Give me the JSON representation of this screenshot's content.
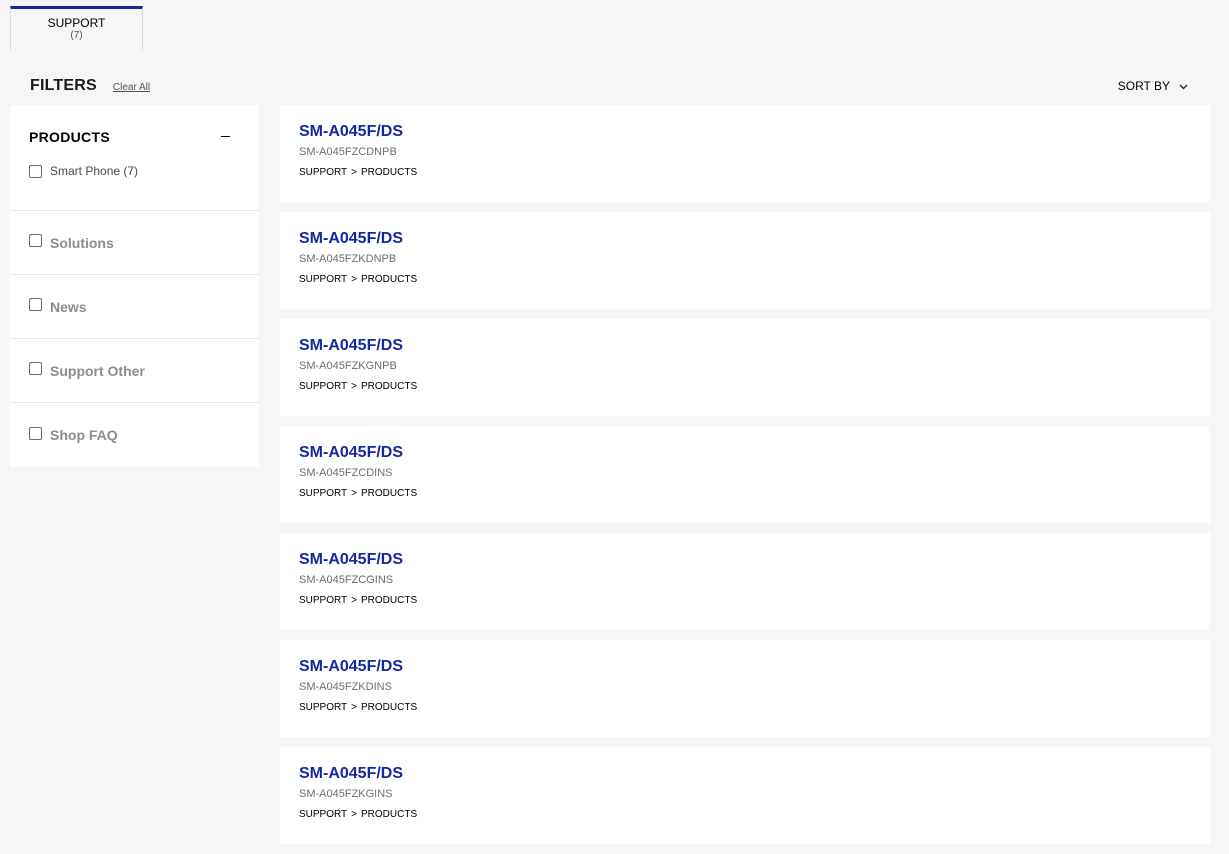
{
  "tabs": [
    {
      "label": "SUPPORT",
      "count": "(7)"
    }
  ],
  "filters": {
    "title": "FILTERS",
    "clear_all": "Clear All",
    "sort_by": "SORT BY"
  },
  "sidebar": {
    "products": {
      "title": "PRODUCTS",
      "collapse_icon": "minus-icon",
      "options": [
        {
          "label": "Smart Phone (7)",
          "checked": false
        }
      ]
    },
    "groups": [
      {
        "label": "Solutions",
        "checked": false
      },
      {
        "label": "News",
        "checked": false
      },
      {
        "label": "Support Other",
        "checked": false
      },
      {
        "label": "Shop FAQ",
        "checked": false
      }
    ]
  },
  "results": [
    {
      "title": "SM-A045F/DS",
      "sku": "SM-A045FZCDNPB",
      "path": [
        "SUPPORT",
        "PRODUCTS"
      ]
    },
    {
      "title": "SM-A045F/DS",
      "sku": "SM-A045FZKDNPB",
      "path": [
        "SUPPORT",
        "PRODUCTS"
      ]
    },
    {
      "title": "SM-A045F/DS",
      "sku": "SM-A045FZKGNPB",
      "path": [
        "SUPPORT",
        "PRODUCTS"
      ]
    },
    {
      "title": "SM-A045F/DS",
      "sku": "SM-A045FZCDINS",
      "path": [
        "SUPPORT",
        "PRODUCTS"
      ]
    },
    {
      "title": "SM-A045F/DS",
      "sku": "SM-A045FZCGINS",
      "path": [
        "SUPPORT",
        "PRODUCTS"
      ]
    },
    {
      "title": "SM-A045F/DS",
      "sku": "SM-A045FZKDINS",
      "path": [
        "SUPPORT",
        "PRODUCTS"
      ]
    },
    {
      "title": "SM-A045F/DS",
      "sku": "SM-A045FZKGINS",
      "path": [
        "SUPPORT",
        "PRODUCTS"
      ]
    }
  ],
  "colors": {
    "accent": "#1428a0",
    "background": "#f6f6f6"
  }
}
